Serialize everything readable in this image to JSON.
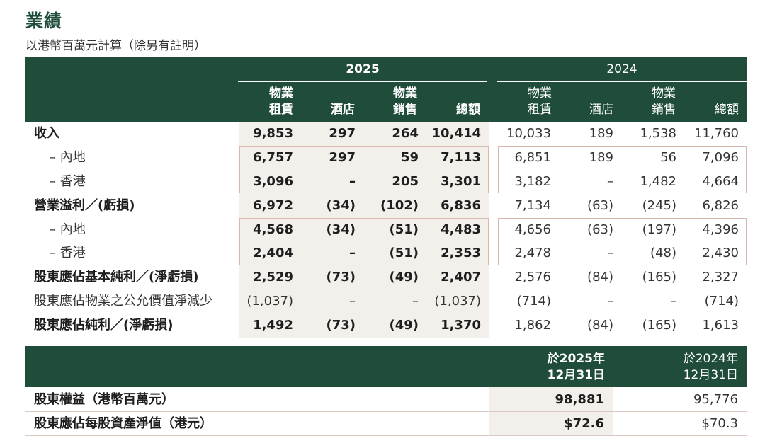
{
  "title": "業績",
  "subtitle": "以港幣百萬元計算（除另有註明）",
  "years": {
    "current": "2025",
    "prior": "2024"
  },
  "columns": [
    {
      "line1": "物業",
      "line2": "租賃"
    },
    {
      "line1": "",
      "line2": "酒店"
    },
    {
      "line1": "物業",
      "line2": "銷售"
    },
    {
      "line1": "",
      "line2": "總額"
    }
  ],
  "rows": [
    {
      "label": "收入",
      "c2025": [
        "9,853",
        "297",
        "264",
        "10,414"
      ],
      "c2024": [
        "10,033",
        "189",
        "1,538",
        "11,760"
      ]
    },
    {
      "label": "– 內地",
      "c2025": [
        "6,757",
        "297",
        "59",
        "7,113"
      ],
      "c2024": [
        "6,851",
        "189",
        "56",
        "7,096"
      ]
    },
    {
      "label": "– 香港",
      "c2025": [
        "3,096",
        "–",
        "205",
        "3,301"
      ],
      "c2024": [
        "3,182",
        "–",
        "1,482",
        "4,664"
      ]
    },
    {
      "label": "營業溢利／(虧損)",
      "c2025": [
        "6,972",
        "(34)",
        "(102)",
        "6,836"
      ],
      "c2024": [
        "7,134",
        "(63)",
        "(245)",
        "6,826"
      ]
    },
    {
      "label": "– 內地",
      "c2025": [
        "4,568",
        "(34)",
        "(51)",
        "4,483"
      ],
      "c2024": [
        "4,656",
        "(63)",
        "(197)",
        "4,396"
      ]
    },
    {
      "label": "– 香港",
      "c2025": [
        "2,404",
        "–",
        "(51)",
        "2,353"
      ],
      "c2024": [
        "2,478",
        "–",
        "(48)",
        "2,430"
      ]
    },
    {
      "label": "股東應佔基本純利／(淨虧損)",
      "c2025": [
        "2,529",
        "(73)",
        "(49)",
        "2,407"
      ],
      "c2024": [
        "2,576",
        "(84)",
        "(165)",
        "2,327"
      ]
    },
    {
      "label": "股東應佔物業之公允價值淨減少",
      "c2025": [
        "(1,037)",
        "–",
        "–",
        "(1,037)"
      ],
      "c2024": [
        "(714)",
        "–",
        "–",
        "(714)"
      ]
    },
    {
      "label": "股東應佔純利／(淨虧損)",
      "c2025": [
        "1,492",
        "(73)",
        "(49)",
        "1,370"
      ],
      "c2024": [
        "1,862",
        "(84)",
        "(165)",
        "1,613"
      ]
    }
  ],
  "balance": {
    "header_current": {
      "line1": "於2025年",
      "line2": "12月31日"
    },
    "header_prior": {
      "line1": "於2024年",
      "line2": "12月31日"
    },
    "rows": [
      {
        "label": "股東權益（港幣百萬元）",
        "current": "98,881",
        "prior": "95,776"
      },
      {
        "label": "股東應佔每股資產淨值（港元）",
        "current": "$72.6",
        "prior": "$70.3"
      }
    ]
  },
  "colors": {
    "header_green": "#1f4d3a",
    "shade": "#f3efea",
    "box_border": "#d7b8ad"
  }
}
